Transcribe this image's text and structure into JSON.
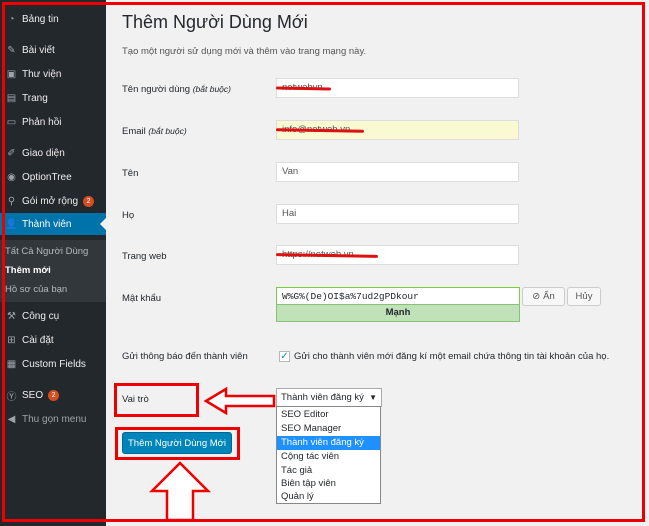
{
  "sidebar": {
    "items": [
      {
        "label": "Bảng tin",
        "icon": "dashboard-icon"
      },
      {
        "label": "Bài viết",
        "icon": "pin-icon"
      },
      {
        "label": "Thư viện",
        "icon": "media-icon"
      },
      {
        "label": "Trang",
        "icon": "page-icon"
      },
      {
        "label": "Phản hồi",
        "icon": "comment-icon"
      },
      {
        "label": "Giao diện",
        "icon": "brush-icon"
      },
      {
        "label": "OptionTree",
        "icon": "option-icon"
      },
      {
        "label": "Gói mở rộng",
        "icon": "plugin-icon",
        "badge": "2"
      },
      {
        "label": "Thành viên",
        "icon": "users-icon",
        "active": true
      },
      {
        "label": "Công cụ",
        "icon": "tools-icon"
      },
      {
        "label": "Cài đặt",
        "icon": "settings-icon"
      },
      {
        "label": "Custom Fields",
        "icon": "fields-icon"
      },
      {
        "label": "SEO",
        "icon": "seo-icon",
        "badge": "2"
      },
      {
        "label": "Thu gọn menu",
        "icon": "collapse-icon"
      }
    ],
    "submenu": [
      "Tất Cả Người Dùng",
      "Thêm mới",
      "Hồ sơ của bạn"
    ]
  },
  "page": {
    "title": "Thêm Người Dùng Mới",
    "description": "Tạo một người sử dụng mới và thêm vào trang mạng này."
  },
  "form": {
    "username_label": "Tên người dùng",
    "username_hint": "(bắt buộc)",
    "username_value": "netwebvn",
    "email_label": "Email",
    "email_hint": "(bắt buộc)",
    "email_value": "info@netweb.vn",
    "firstname_label": "Tên",
    "firstname_value": "Van",
    "lastname_label": "Họ",
    "lastname_value": "Hai",
    "website_label": "Trang web",
    "website_value": "https://netweb.vn",
    "password_label": "Mật khẩu",
    "password_value": "W%G%(De)OI$a%7ud2gPDkour",
    "strength": "Mạnh",
    "hide_label": "Ẩn",
    "cancel_label": "Hủy",
    "notify_label": "Gửi thông báo đến thành viên",
    "notify_text": "Gửi cho thành viên mới đăng kí một email chứa thông tin tài khoản của họ.",
    "notify_checked": true,
    "role_label": "Vai trò",
    "role_selected": "Thành viên đăng ký",
    "role_options": [
      "SEO Editor",
      "SEO Manager",
      "Thành viên đăng ký",
      "Cộng tác viên",
      "Tác giả",
      "Biên tập viên",
      "Quản lý"
    ],
    "submit_label": "Thêm Người Dùng Mới"
  },
  "colors": {
    "sidebar_bg": "#23282d",
    "accent": "#0073aa",
    "primary_button": "#0085ba",
    "annotation": "#e00000",
    "strength_ok": "#c1e1b9"
  }
}
